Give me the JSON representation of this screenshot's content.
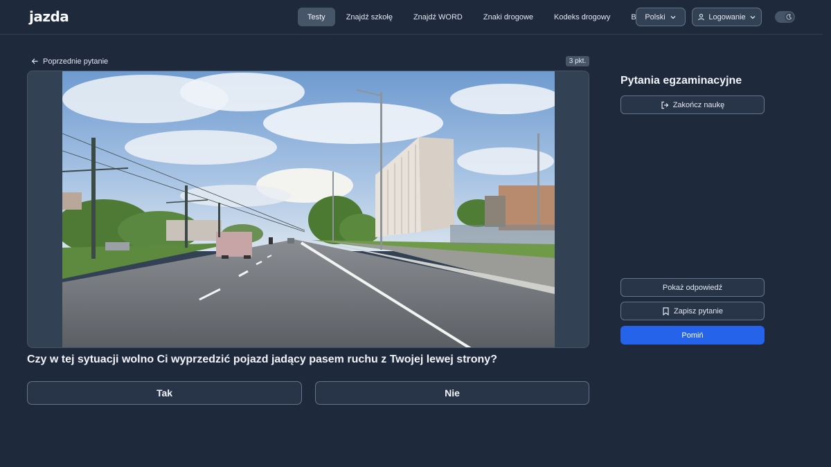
{
  "header": {
    "logo_text": "jazda",
    "nav": [
      {
        "label": "Testy",
        "active": true
      },
      {
        "label": "Znajdź szkołę",
        "active": false
      },
      {
        "label": "Znajdź WORD",
        "active": false
      },
      {
        "label": "Znaki drogowe",
        "active": false
      },
      {
        "label": "Kodeks drogowy",
        "active": false
      },
      {
        "label": "Blog",
        "active": false
      }
    ],
    "language": "Polski",
    "login": "Logowanie",
    "theme_icon": "moon-icon"
  },
  "question_panel": {
    "prev_label": "Poprzednie pytanie",
    "points": "3 pkt.",
    "question": "Czy w tej sytuacji wolno Ci wyprzedzić pojazd jadący pasem ruchu z Twojej lewej strony?",
    "answers": {
      "yes": "Tak",
      "no": "Nie"
    }
  },
  "sidebar": {
    "title": "Pytania egzaminacyjne",
    "end_label": "Zakończ naukę",
    "show_answer_label": "Pokaż odpowiedź",
    "save_label": "Zapisz pytanie",
    "skip_label": "Pomiń"
  },
  "colors": {
    "background": "#1e293b",
    "accent": "#2563eb",
    "active_nav": "#475569"
  }
}
